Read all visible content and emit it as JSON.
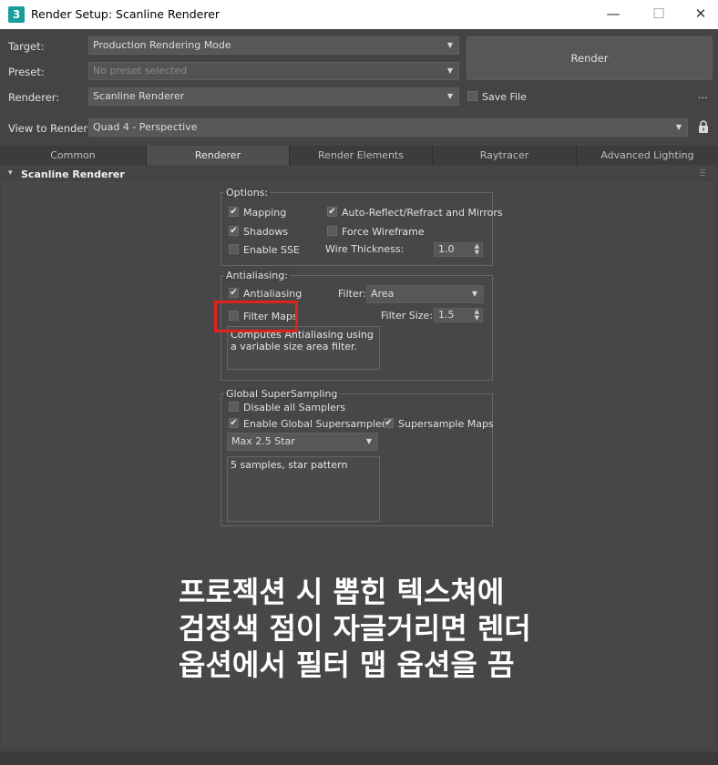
{
  "window": {
    "title": "Render Setup: Scanline Renderer",
    "app_icon_text": "3",
    "minimize": "—",
    "maximize": "☐",
    "close": "✕"
  },
  "top_form": {
    "target_label": "Target:",
    "target_value": "Production Rendering Mode",
    "preset_label": "Preset:",
    "preset_placeholder": "No preset selected",
    "renderer_label": "Renderer:",
    "renderer_value": "Scanline Renderer",
    "save_file_label": "Save File",
    "save_file_checked": false,
    "more_label": "...",
    "view_label": "View to Render:",
    "view_value": "Quad 4 - Perspective",
    "render_button": "Render"
  },
  "tabs": [
    {
      "label": "Common",
      "active": false
    },
    {
      "label": "Renderer",
      "active": true
    },
    {
      "label": "Render Elements",
      "active": false
    },
    {
      "label": "Raytracer",
      "active": false
    },
    {
      "label": "Advanced Lighting",
      "active": false
    }
  ],
  "rollout": {
    "title": "Scanline Renderer",
    "collapse_glyph": "▾"
  },
  "options": {
    "title": "Options:",
    "mapping_label": "Mapping",
    "mapping_checked": true,
    "shadows_label": "Shadows",
    "shadows_checked": true,
    "enable_sse_label": "Enable SSE",
    "enable_sse_checked": false,
    "auto_reflect_label": "Auto-Reflect/Refract and Mirrors",
    "auto_reflect_checked": true,
    "force_wireframe_label": "Force Wireframe",
    "force_wireframe_checked": false,
    "wire_thickness_label": "Wire Thickness:",
    "wire_thickness_value": "1.0"
  },
  "antialiasing": {
    "title": "Antialiasing:",
    "antialiasing_label": "Antialiasing",
    "antialiasing_checked": true,
    "filter_maps_label": "Filter Maps",
    "filter_maps_checked": false,
    "filter_label": "Filter:",
    "filter_value": "Area",
    "filter_size_label": "Filter Size:",
    "filter_size_value": "1.5",
    "description": "Computes Antialiasing using a variable size area filter."
  },
  "supersampling": {
    "title": "Global SuperSampling",
    "disable_all_label": "Disable all Samplers",
    "disable_all_checked": false,
    "enable_global_label": "Enable Global Supersampler",
    "enable_global_checked": true,
    "supersample_maps_label": "Supersample Maps",
    "supersample_maps_checked": true,
    "sampler_value": "Max 2.5 Star",
    "description": "5 samples, star pattern"
  },
  "caption": {
    "line1": "프로젝션 시 뽑힌 텍스쳐에",
    "line2": "검정색 점이 자글거리면 렌더",
    "line3": "옵션에서 필터 맵 옵션을 끔"
  },
  "colors": {
    "highlight": "#e0221f",
    "panel_bg": "#444444"
  }
}
